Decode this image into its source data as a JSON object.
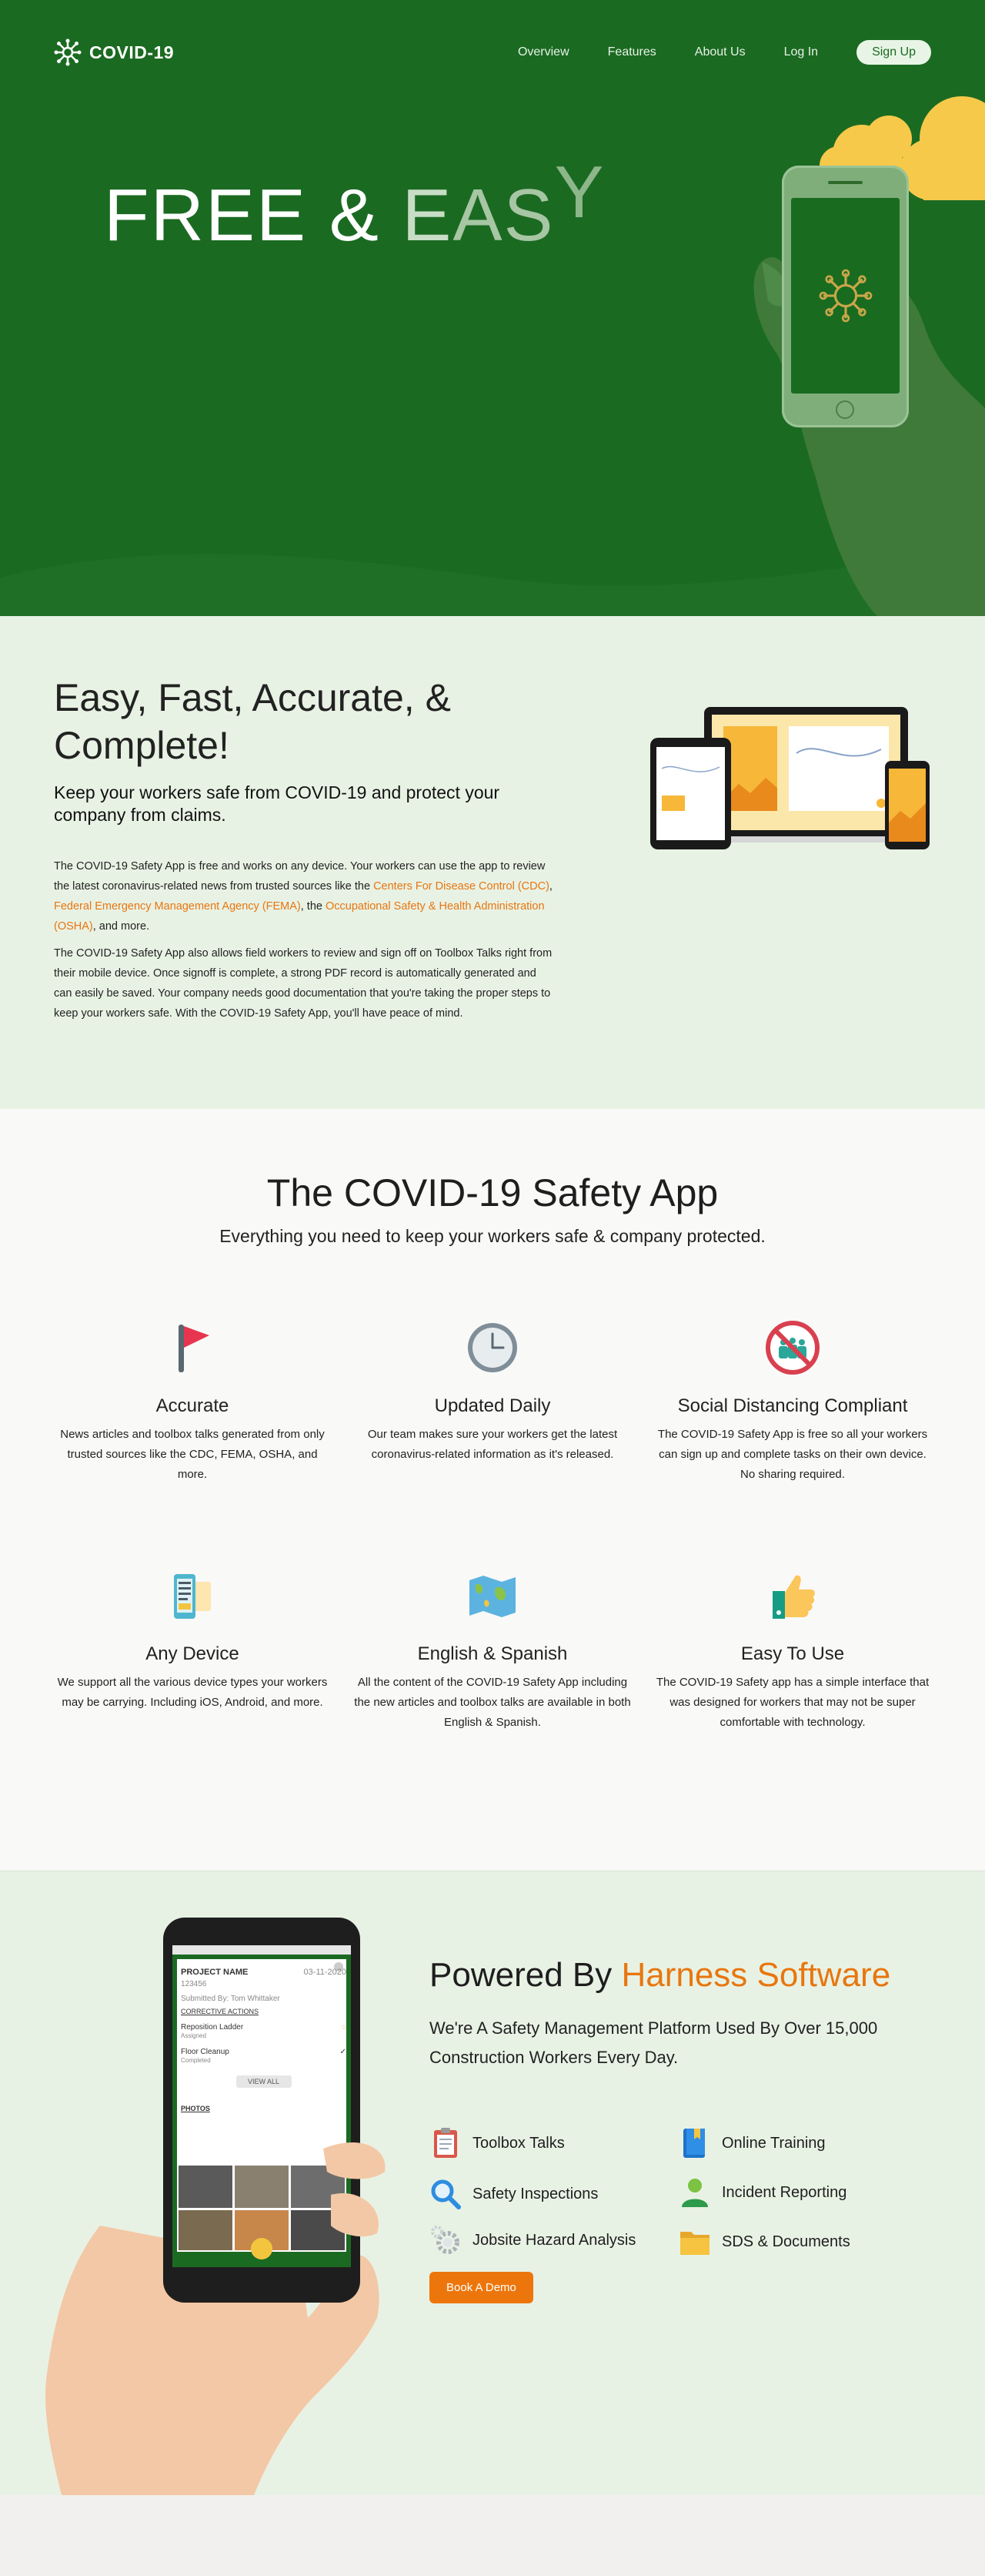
{
  "nav": {
    "brand": "COVID-19",
    "links": [
      "Overview",
      "Features",
      "About Us",
      "Log In"
    ],
    "signup": "Sign Up"
  },
  "hero": {
    "title_part1": "FREE & ",
    "title_e": "E",
    "title_a": "A",
    "title_s": "S",
    "title_y": "Y"
  },
  "intro": {
    "heading": "Easy, Fast, Accurate, & Complete!",
    "subheading": "Keep your workers safe from COVID-19 and protect your company from claims.",
    "p1_text1": "The COVID-19 Safety App is free and works on any device.  Your workers can use the app to review the latest coronavirus-related news from trusted sources like the ",
    "link_cdc": "Centers For Disease Control (CDC)",
    "p1_sep1": ", ",
    "link_fema": "Federal Emergency Management Agency (FEMA)",
    "p1_sep2": ", the ",
    "link_osha": "Occupational Safety & Health Administration (OSHA)",
    "p1_end": ", and more.",
    "p2": "The COVID-19 Safety App also allows field workers to review and sign off on Toolbox Talks right from their mobile device. Once signoff is complete, a strong PDF record is automatically generated and can easily be saved. Your company needs good documentation that you're taking the proper steps to keep your workers safe. With the COVID-19 Safety App, you'll have peace of mind."
  },
  "features": {
    "heading": "The COVID-19 Safety App",
    "tagline": "Everything you need to keep your workers safe & company protected.",
    "items": [
      {
        "title": "Accurate",
        "text": "News articles and toolbox talks generated from only trusted sources like the CDC, FEMA, OSHA, and more.",
        "icon": "flag-icon"
      },
      {
        "title": "Updated Daily",
        "text": "Our team makes sure your workers get the latest coronavirus-related information as it's released.",
        "icon": "clock-icon"
      },
      {
        "title": "Social Distancing Compliant",
        "text": "The COVID-19 Safety App is free so all your workers can sign up and complete tasks on their own device. No sharing required.",
        "icon": "no-crowd-icon"
      },
      {
        "title": "Any Device",
        "text": "We support all the various device types your workers may be carrying. Including iOS, Android, and more.",
        "icon": "devices-icon"
      },
      {
        "title": "English & Spanish",
        "text": "All the content of the COVID-19 Safety App including the new articles and toolbox talks are available in both English & Spanish.",
        "icon": "map-icon"
      },
      {
        "title": "Easy To Use",
        "text": "The COVID-19 Safety app has a simple interface that was designed for workers that may not be super comfortable with technology.",
        "icon": "thumbs-up-icon"
      }
    ]
  },
  "powered": {
    "heading_prefix": "Powered By ",
    "heading_accent": "Harness Software",
    "subheading": "We're A Safety Management Platform Used By Over 15,000 Construction Workers Every Day.",
    "left_items": [
      "Toolbox Talks",
      "Safety Inspections",
      "Jobsite Hazard Analysis"
    ],
    "right_items": [
      "Online Training",
      "Incident Reporting",
      "SDS & Documents"
    ],
    "cta": "Book A Demo",
    "app_screen": {
      "project_label": "PROJECT NAME",
      "date": "03-11-2020",
      "project_id": "123456",
      "submitted": "Submitted By: Tom Whittaker",
      "corrective": "CORRECTIVE ACTIONS",
      "task1": "Reposition Ladder",
      "task1_status": "Assigned",
      "task2": "Floor Cleanup",
      "task2_status": "Completed",
      "view_all": "VIEW ALL",
      "photos": "PHOTOS"
    }
  },
  "colors": {
    "hero_green": "#1b6a22",
    "light_green": "#e8f2e4",
    "accent_orange": "#e8760f"
  }
}
